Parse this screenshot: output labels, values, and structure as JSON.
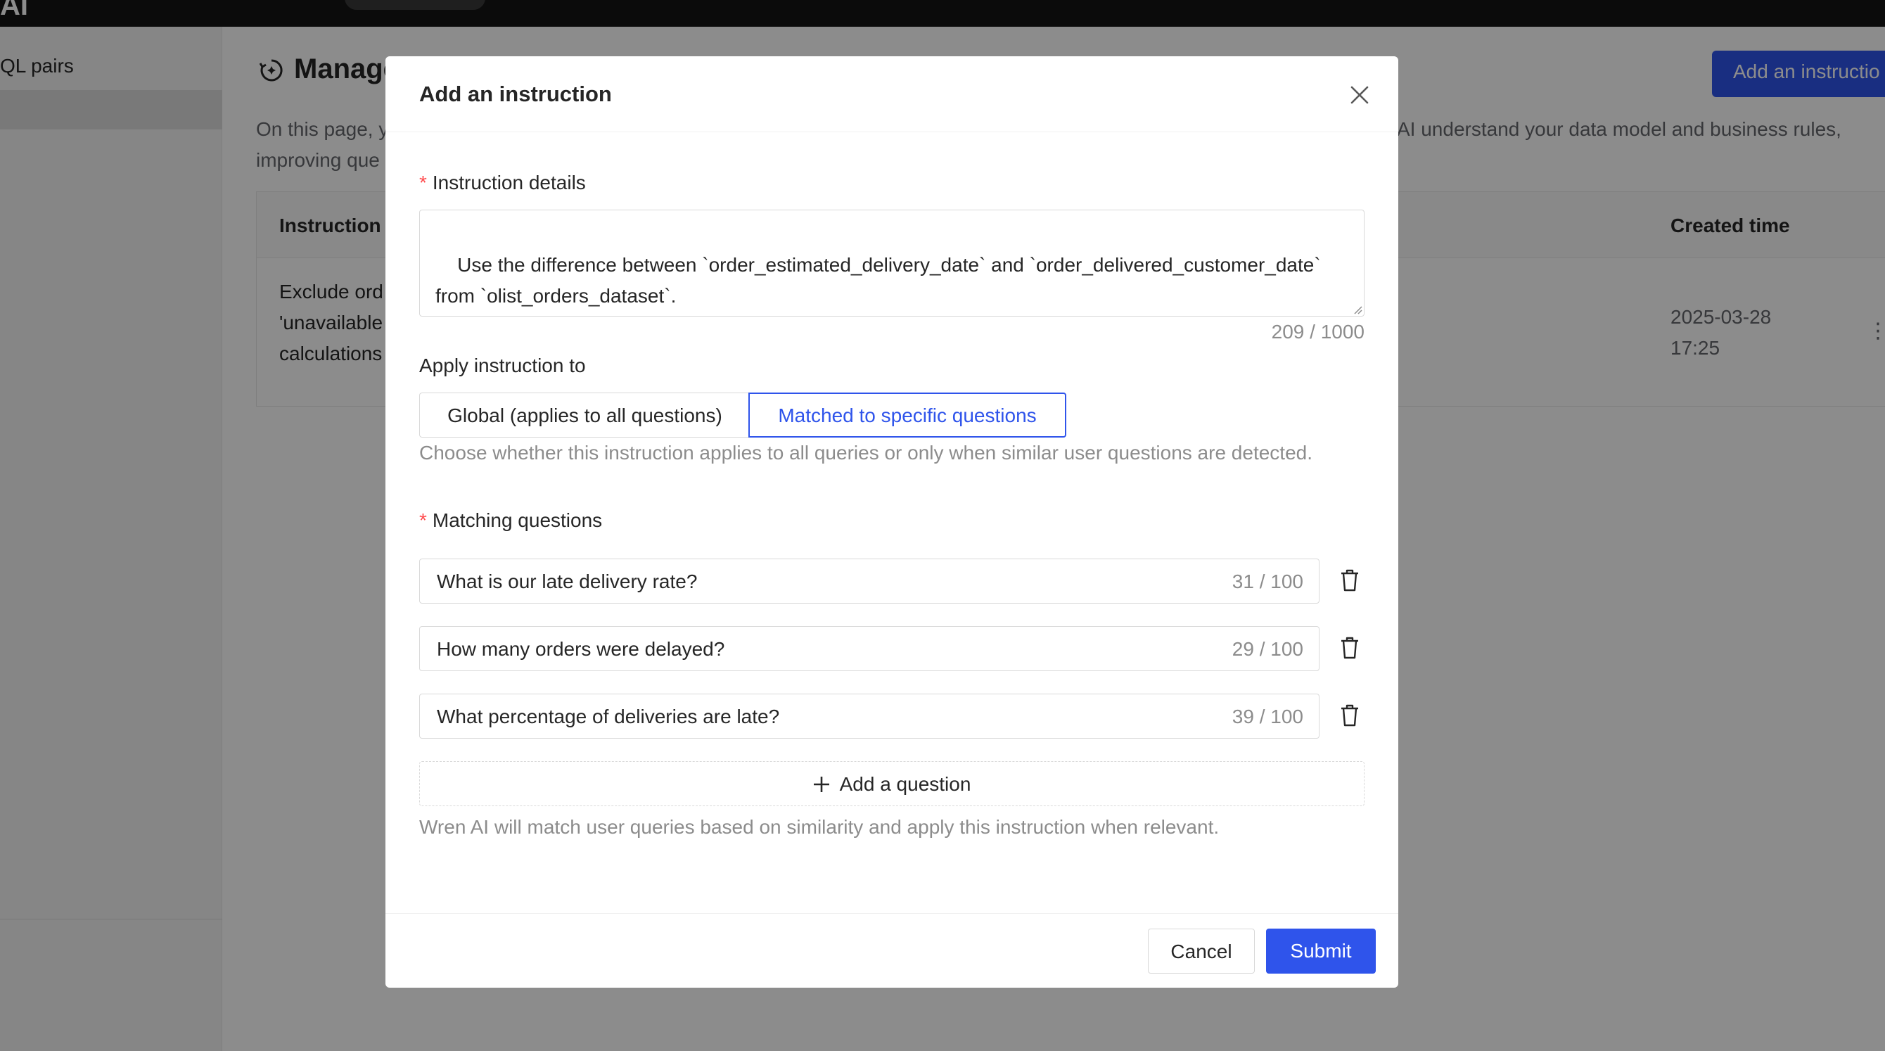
{
  "sidebar": {
    "item_label": "QL pairs"
  },
  "main": {
    "title": "Manage",
    "description_line1": "On this page, y",
    "description_line1_right": "AI understand your data model and business rules,",
    "description_line2": "improving que",
    "add_button_label": "Add an instructio",
    "table": {
      "headers": {
        "instruction": "Instruction",
        "created_time": "Created time"
      },
      "row": {
        "instruction_text": "Exclude ord\n'unavailable\ncalculations",
        "created_time": "2025-03-28\n17:25"
      }
    }
  },
  "modal": {
    "title": "Add an instruction",
    "details_label": "Instruction details",
    "details_value": "Use the difference between `order_estimated_delivery_date` and `order_delivered_customer_date`\nfrom `olist_orders_dataset`.\nIf the delivered date is later than the estimated date, consider it a late delivery.",
    "details_count": "209 / 1000",
    "apply_label": "Apply instruction to",
    "apply_options": {
      "global": "Global (applies to all questions)",
      "matched": "Matched to specific questions"
    },
    "apply_selected": "matched",
    "apply_help": "Choose whether this instruction applies to all queries or only when similar user questions are detected.",
    "matching_label": "Matching questions",
    "questions": [
      {
        "text": "What is our late delivery rate?",
        "count": "31 / 100"
      },
      {
        "text": "How many orders were delayed?",
        "count": "29 / 100"
      },
      {
        "text": "What percentage of deliveries are late?",
        "count": "39 / 100"
      }
    ],
    "add_question_label": "Add a question",
    "matching_help": "Wren AI will match user queries based on similarity and apply this instruction when relevant.",
    "cancel_label": "Cancel",
    "submit_label": "Submit"
  },
  "colors": {
    "primary": "#2f54eb",
    "required": "#ff4d4f",
    "muted_text": "#8c8c8c",
    "topbar": "#141414"
  }
}
